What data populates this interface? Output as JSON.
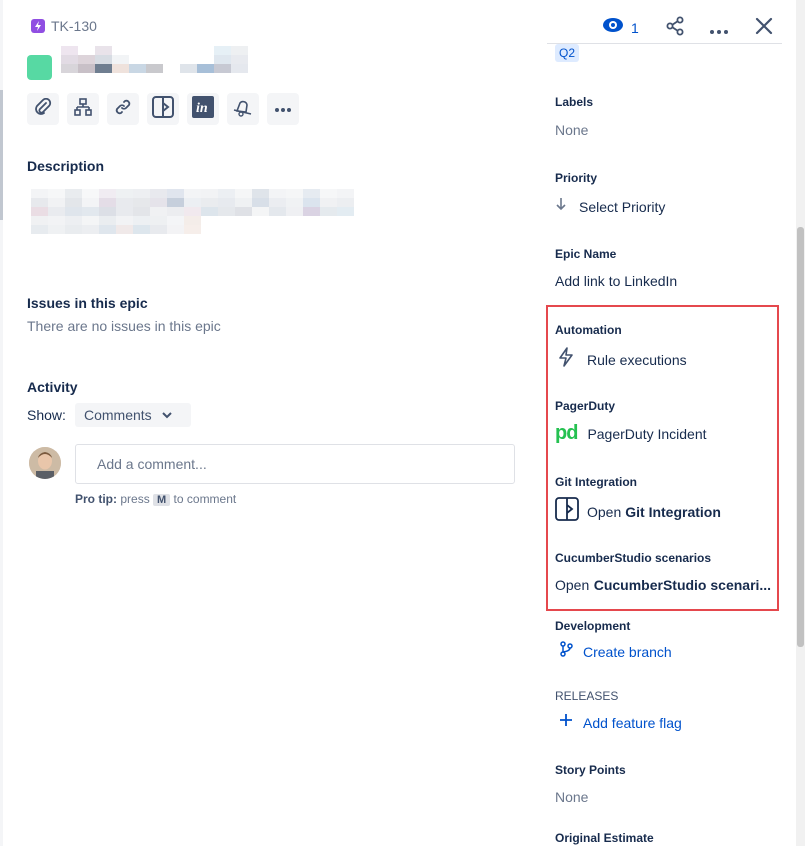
{
  "header": {
    "issue_key": "TK-130",
    "watch_count": "1"
  },
  "colors": {
    "epic_swatch": "#57d9a3",
    "epic_icon": "#904ee2",
    "link": "#0052cc",
    "highlight_border": "#e5484d"
  },
  "toolbar": {
    "icons": [
      "paperclip-icon",
      "child-issues-icon",
      "link-icon",
      "git-integration-icon",
      "invision-icon",
      "bell-icon",
      "more-icon"
    ]
  },
  "description": {
    "title": "Description"
  },
  "epic_issues": {
    "title": "Issues in this epic",
    "empty_text": "There are no issues in this epic"
  },
  "activity": {
    "title": "Activity",
    "show_label": "Show:",
    "show_value": "Comments",
    "comment_placeholder": "Add a comment...",
    "pro_tip_label": "Pro tip:",
    "pro_tip_pre": "press",
    "pro_tip_key": "M",
    "pro_tip_post": "to comment"
  },
  "sidebar": {
    "sprint_tag": "Q2",
    "labels": {
      "label": "Labels",
      "value": "None"
    },
    "priority": {
      "label": "Priority",
      "value": "Select Priority"
    },
    "epic_name": {
      "label": "Epic Name",
      "value": "Add link to LinkedIn"
    },
    "automation": {
      "label": "Automation",
      "value": "Rule executions"
    },
    "pagerduty": {
      "label": "PagerDuty",
      "value": "PagerDuty Incident",
      "logo_text": "pd"
    },
    "git": {
      "label": "Git Integration",
      "value_prefix": "Open",
      "value_bold": "Git Integration"
    },
    "cucumber": {
      "label": "CucumberStudio scenarios",
      "value_prefix": "Open",
      "value_bold": "CucumberStudio scenari..."
    },
    "development": {
      "label": "Development",
      "value": "Create branch"
    },
    "releases": {
      "label": "RELEASES",
      "value": "Add feature flag"
    },
    "story_points": {
      "label": "Story Points",
      "value": "None"
    },
    "original_estimate": {
      "label": "Original Estimate"
    }
  }
}
